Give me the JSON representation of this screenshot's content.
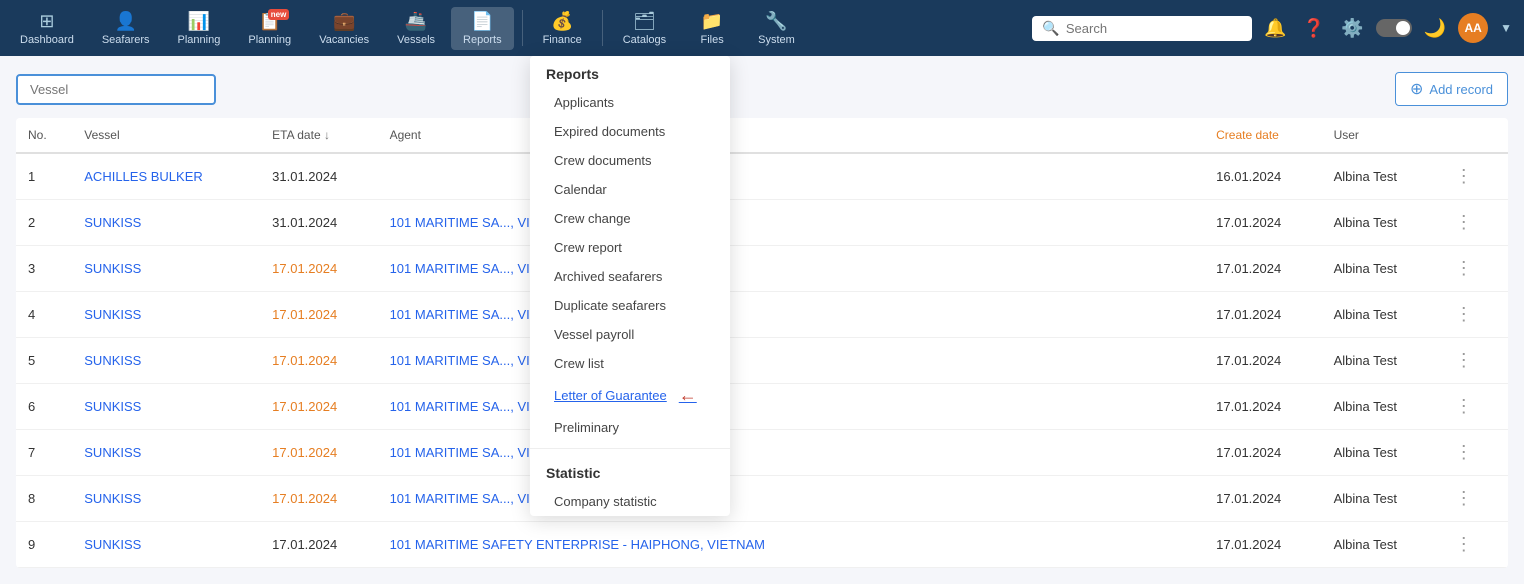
{
  "nav": {
    "items": [
      {
        "id": "dashboard",
        "label": "Dashboard",
        "icon": "⊞"
      },
      {
        "id": "seafarers",
        "label": "Seafarers",
        "icon": "👤"
      },
      {
        "id": "planning",
        "label": "Planning",
        "icon": "📊",
        "badge": ""
      },
      {
        "id": "planning2",
        "label": "Planning",
        "icon": "📋",
        "badge": "new"
      },
      {
        "id": "vacancies",
        "label": "Vacancies",
        "icon": "💼"
      },
      {
        "id": "vessels",
        "label": "Vessels",
        "icon": "🚢"
      },
      {
        "id": "reports",
        "label": "Reports",
        "icon": "📄",
        "active": true,
        "hasArrow": true
      },
      {
        "id": "finance",
        "label": "Finance",
        "icon": "💰",
        "hasArrow": true
      },
      {
        "id": "catalogs",
        "label": "Catalogs",
        "icon": "🗂",
        "hasArrow": true
      },
      {
        "id": "files",
        "label": "Files",
        "icon": "📁"
      },
      {
        "id": "system",
        "label": "System",
        "icon": "🔧",
        "hasArrow": true
      }
    ],
    "search_placeholder": "Search",
    "avatar_initials": "AA"
  },
  "reports_dropdown": {
    "title": "Reports",
    "items": [
      {
        "id": "applicants",
        "label": "Applicants"
      },
      {
        "id": "expired-docs",
        "label": "Expired documents"
      },
      {
        "id": "crew-docs",
        "label": "Crew documents"
      },
      {
        "id": "calendar",
        "label": "Calendar"
      },
      {
        "id": "crew-change",
        "label": "Crew change"
      },
      {
        "id": "crew-report",
        "label": "Crew report"
      },
      {
        "id": "archived-seafarers",
        "label": "Archived seafarers"
      },
      {
        "id": "duplicate-seafarers",
        "label": "Duplicate seafarers"
      },
      {
        "id": "vessel-payroll",
        "label": "Vessel payroll"
      },
      {
        "id": "crew-list",
        "label": "Crew list"
      },
      {
        "id": "letter-of-guarantee",
        "label": "Letter of Guarantee",
        "highlighted": true,
        "arrow": true
      },
      {
        "id": "preliminary",
        "label": "Preliminary"
      }
    ],
    "statistic_title": "Statistic",
    "statistic_items": [
      {
        "id": "company-statistic",
        "label": "Company statistic"
      }
    ]
  },
  "page": {
    "vessel_placeholder": "Vessel",
    "add_record_label": "Add record",
    "columns": [
      "No.",
      "Vessel",
      "ETA date",
      "Agent",
      "Create date",
      "User"
    ],
    "rows": [
      {
        "no": 1,
        "vessel": "ACHILLES BULKER",
        "eta": "31.01.2024",
        "eta_color": "normal",
        "agent": "",
        "create_date": "16.01.2024",
        "user": "Albina Test"
      },
      {
        "no": 2,
        "vessel": "SUNKISS",
        "eta": "31.01.2024",
        "eta_color": "normal",
        "agent": "101 MARITIME SA",
        "agent_suffix": "..., VIETNAM",
        "create_date": "17.01.2024",
        "user": "Albina Test"
      },
      {
        "no": 3,
        "vessel": "SUNKISS",
        "eta": "17.01.2024",
        "eta_color": "orange",
        "agent": "101 MARITIME SA",
        "agent_suffix": "..., VIETNAM",
        "create_date": "17.01.2024",
        "user": "Albina Test"
      },
      {
        "no": 4,
        "vessel": "SUNKISS",
        "eta": "17.01.2024",
        "eta_color": "orange",
        "agent": "101 MARITIME SA",
        "agent_suffix": "..., VIETNAM",
        "create_date": "17.01.2024",
        "user": "Albina Test"
      },
      {
        "no": 5,
        "vessel": "SUNKISS",
        "eta": "17.01.2024",
        "eta_color": "orange",
        "agent": "101 MARITIME SA",
        "agent_suffix": "..., VIETNAM",
        "create_date": "17.01.2024",
        "user": "Albina Test"
      },
      {
        "no": 6,
        "vessel": "SUNKISS",
        "eta": "17.01.2024",
        "eta_color": "orange",
        "agent": "101 MARITIME SA",
        "agent_suffix": "..., VIETNAM",
        "create_date": "17.01.2024",
        "user": "Albina Test"
      },
      {
        "no": 7,
        "vessel": "SUNKISS",
        "eta": "17.01.2024",
        "eta_color": "orange",
        "agent": "101 MARITIME SA",
        "agent_suffix": "..., VIETNAM",
        "create_date": "17.01.2024",
        "user": "Albina Test"
      },
      {
        "no": 8,
        "vessel": "SUNKISS",
        "eta": "17.01.2024",
        "eta_color": "orange",
        "agent": "101 MARITIME SA",
        "agent_suffix": "..., VIETNAM",
        "create_date": "17.01.2024",
        "user": "Albina Test"
      },
      {
        "no": 9,
        "vessel": "SUNKISS",
        "eta": "17.01.2024",
        "eta_color": "normal",
        "agent": "101 MARITIME SAFETY ENTERPRISE - HAIPHONG, VIETNAM",
        "create_date": "17.01.2024",
        "user": "Albina Test"
      }
    ]
  }
}
